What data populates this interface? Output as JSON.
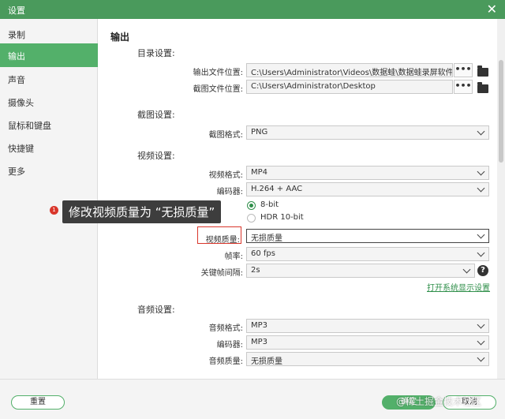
{
  "window": {
    "title": "设置",
    "close_glyph": "✕"
  },
  "sidebar": {
    "items": [
      {
        "label": "录制"
      },
      {
        "label": "输出"
      },
      {
        "label": "声音"
      },
      {
        "label": "摄像头"
      },
      {
        "label": "鼠标和键盘"
      },
      {
        "label": "快捷键"
      },
      {
        "label": "更多"
      }
    ],
    "active_index": 1
  },
  "main": {
    "heading": "输出",
    "directory": {
      "section_label": "目录设置:",
      "output_label": "输出文件位置:",
      "output_value": "C:\\Users\\Administrator\\Videos\\数据蛙\\数据蛙录屏软件",
      "screenshot_label": "截图文件位置:",
      "screenshot_value": "C:\\Users\\Administrator\\Desktop",
      "browse_glyph": "•••"
    },
    "screenshot": {
      "section_label": "截图设置:",
      "format_label": "截图格式:",
      "format_value": "PNG"
    },
    "video": {
      "section_label": "视频设置:",
      "format_label": "视频格式:",
      "format_value": "MP4",
      "encoder_label": "编码器:",
      "encoder_value": "H.264 + AAC",
      "bitdepth_8": "8-bit",
      "bitdepth_10": "HDR 10-bit",
      "quality_label": "视频质量:",
      "quality_value": "无损质量",
      "framerate_label": "帧率:",
      "framerate_value": "60 fps",
      "keyframe_label": "关键帧间隔:",
      "keyframe_value": "2s",
      "help_glyph": "?",
      "display_link": "打开系统显示设置"
    },
    "audio": {
      "section_label": "音频设置:",
      "format_label": "音频格式:",
      "format_value": "MP3",
      "encoder_label": "编码器:",
      "encoder_value": "MP3",
      "quality_label": "音频质量:",
      "quality_value": "无损质量"
    }
  },
  "annotation": {
    "badge": "1",
    "text": "修改视频质量为 “无损质量”"
  },
  "footer": {
    "reset_label": "重置",
    "ok_label": "确定",
    "cancel_label": "取消"
  },
  "watermark": "@稀土掘金技术社区",
  "colors": {
    "accent": "#53b06a",
    "titlebar": "#4a9a5c",
    "highlight": "#d9362b"
  }
}
